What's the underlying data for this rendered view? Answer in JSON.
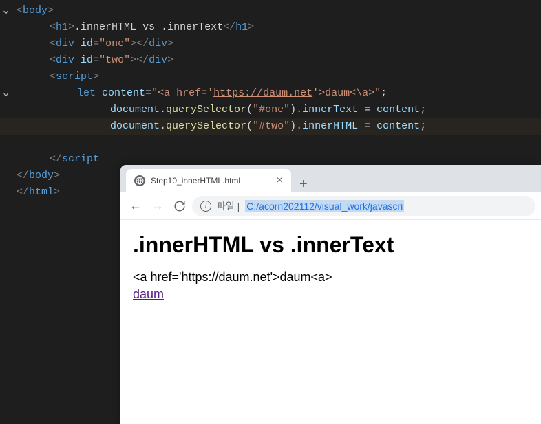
{
  "code": {
    "body_tag": "body",
    "h1_tag": "h1",
    "h1_text": ".innerHTML vs .innerText",
    "div_tag": "div",
    "id_attr": "id",
    "id_one": "\"one\"",
    "id_two": "\"two\"",
    "script_tag": "script",
    "let_kw": "let",
    "content_var": "content",
    "content_str_1": "\"<a href='",
    "content_url": "https://daum.net",
    "content_str_2": "'>daum<\\a>\"",
    "document_var": "document",
    "queryselector": "querySelector",
    "sel_one": "\"#one\"",
    "sel_two": "\"#two\"",
    "innertext": "innerText",
    "innerhtml": "innerHTML",
    "html_tag": "html"
  },
  "browser": {
    "tab_title": "Step10_innerHTML.html",
    "url_prefix": "파일 |",
    "url_path": "C:/acorn202112/visual_work/javascri",
    "h1": ".innerHTML vs .innerText",
    "line1": "<a href='https://daum.net'>daum<a>",
    "link": "daum"
  }
}
